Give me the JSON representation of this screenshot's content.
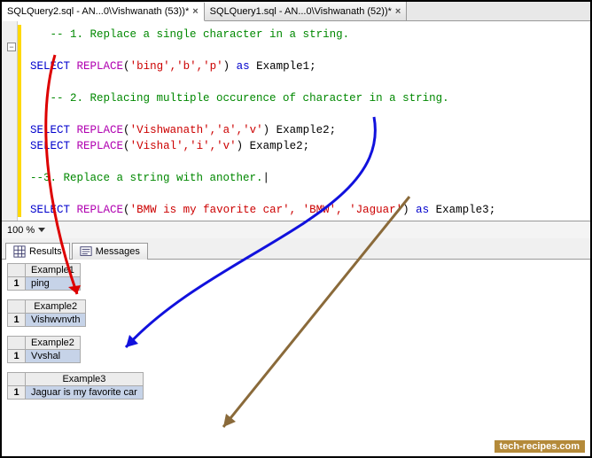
{
  "tabs": [
    {
      "label": "SQLQuery2.sql - AN...0\\Vishwanath (53))*"
    },
    {
      "label": "SQLQuery1.sql - AN...0\\Vishwanath (52))*"
    }
  ],
  "code": {
    "c1": "-- 1. Replace a single character in a string.",
    "kw_select": "SELECT",
    "fn_replace": "REPLACE",
    "l2_args": "'bing','b','p'",
    "kw_as": "as",
    "l2_alias": "Example1",
    "c2": "-- 2. Replacing multiple occurence of character in a string.",
    "l4_args": "'Vishwanath','a','v'",
    "l4_alias": "Example2",
    "l5_args": "'Vishal','i','v'",
    "l5_alias": "Example2",
    "c3": "--3. Replace a string with another.",
    "l7_args": "'BMW is my favorite car', 'BMW', 'Jaguar'",
    "l7_alias": "Example3"
  },
  "zoom": "100 %",
  "result_tabs": {
    "results": "Results",
    "messages": "Messages"
  },
  "grids": [
    {
      "header": "Example1",
      "row": "1",
      "value": "ping"
    },
    {
      "header": "Example2",
      "row": "1",
      "value": "Vishwvnvth"
    },
    {
      "header": "Example2",
      "row": "1",
      "value": "Vvshal"
    },
    {
      "header": "Example3",
      "row": "1",
      "value": "Jaguar is my favorite car"
    }
  ],
  "watermark": "tech-recipes.com"
}
